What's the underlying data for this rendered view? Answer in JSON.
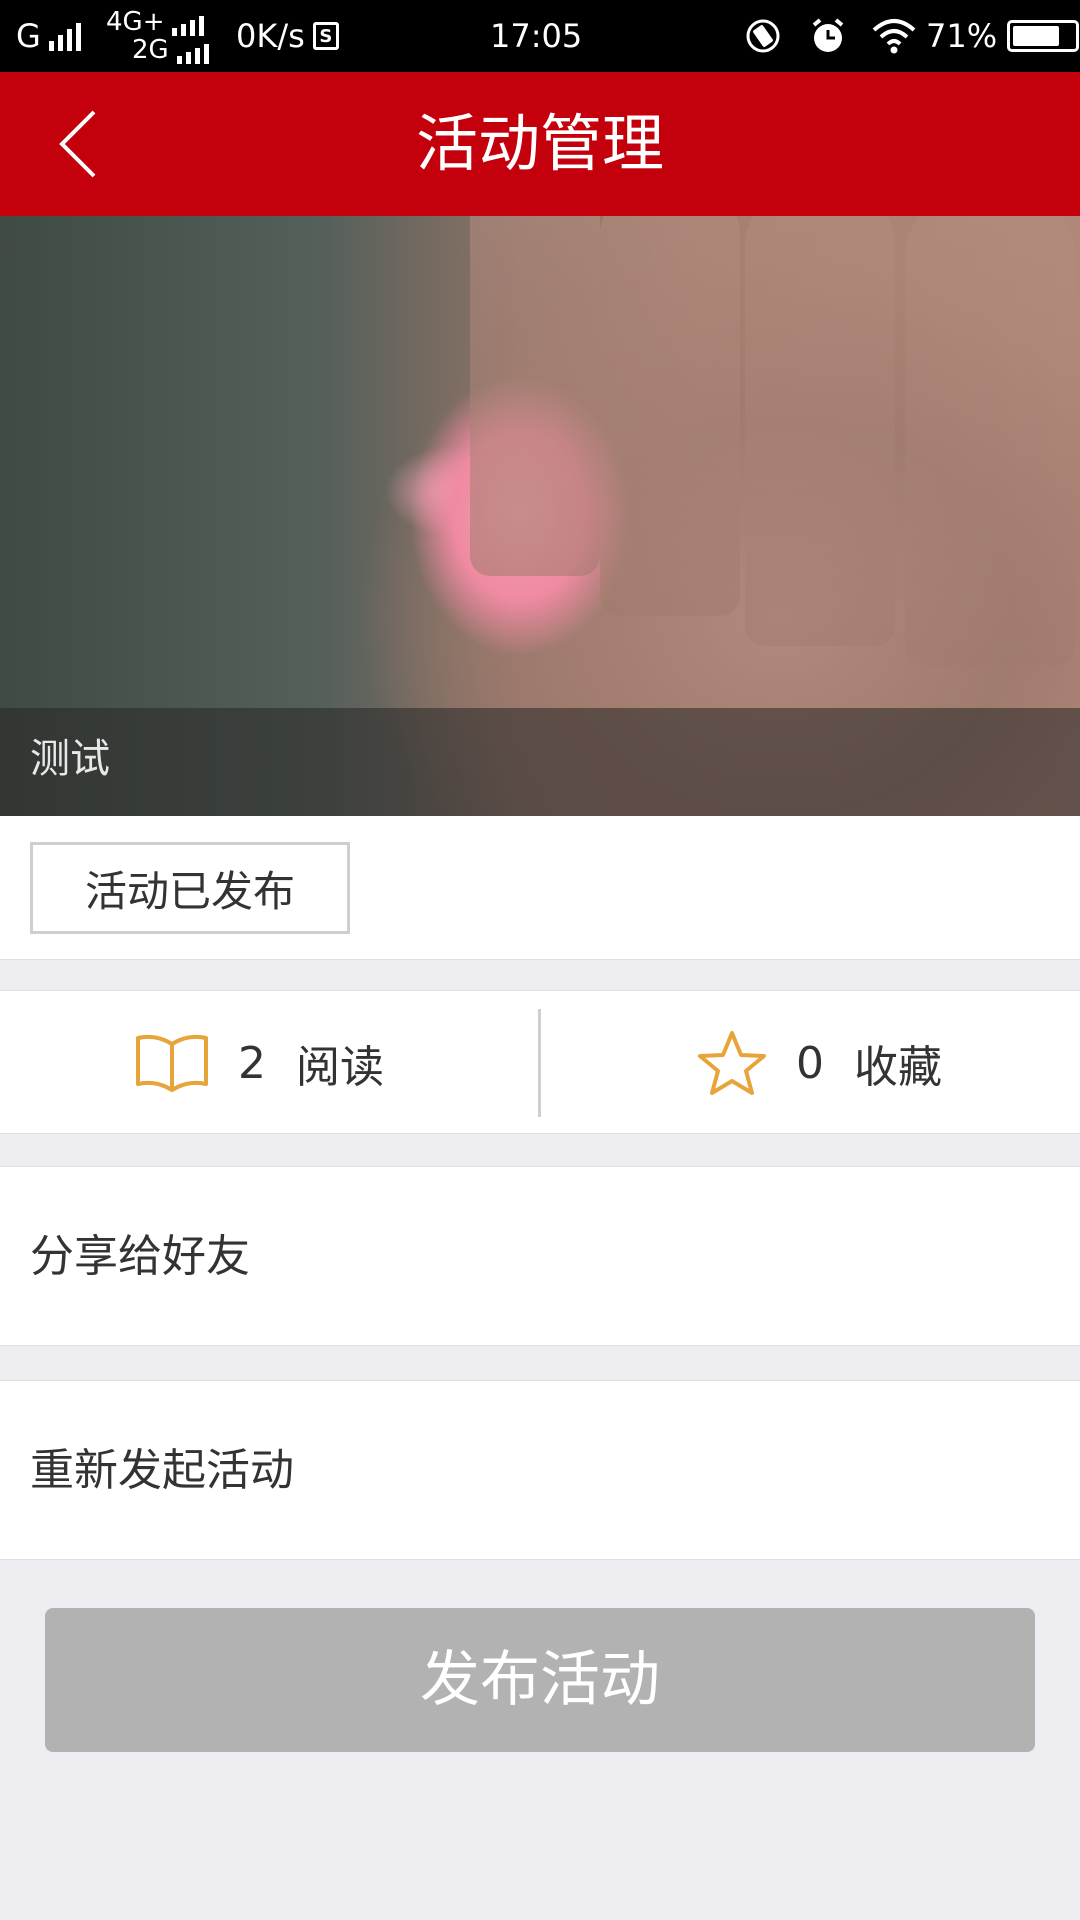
{
  "status_bar": {
    "carrier1": "G",
    "carrier2_top": "4G+",
    "carrier2_bottom": "2G",
    "net_speed": "0K/s",
    "time": "17:05",
    "battery": "71%"
  },
  "header": {
    "title": "活动管理"
  },
  "banner": {
    "caption": "测试"
  },
  "status_tag": {
    "label": "活动已发布"
  },
  "stats": {
    "reads": {
      "count": "2",
      "label": "阅读",
      "icon": "book-icon"
    },
    "favorites": {
      "count": "0",
      "label": "收藏",
      "icon": "star-icon"
    }
  },
  "actions": {
    "share": "分享给好友",
    "relaunch": "重新发起活动"
  },
  "publish_button": {
    "label": "发布活动"
  },
  "colors": {
    "header_bg": "#c3000b",
    "icon_accent": "#e6a43a",
    "button_disabled": "#b2b2b2"
  }
}
